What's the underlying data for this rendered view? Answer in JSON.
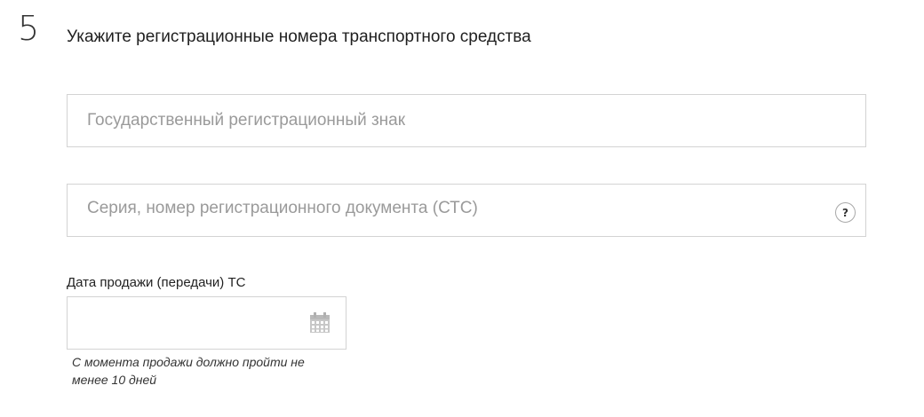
{
  "step": {
    "number": "5",
    "title": "Укажите регистрационные номера транспортного средства"
  },
  "fields": {
    "plate": {
      "placeholder": "Государственный регистрационный знак",
      "value": ""
    },
    "registration_doc": {
      "placeholder": "Серия, номер регистрационного документа (СТС)",
      "value": "",
      "help_label": "?"
    },
    "sale_date": {
      "label": "Дата продажи (передачи) ТС",
      "value": "",
      "icon": "calendar-icon",
      "hint": "С момента продажи должно пройти не менее 10 дней"
    }
  }
}
